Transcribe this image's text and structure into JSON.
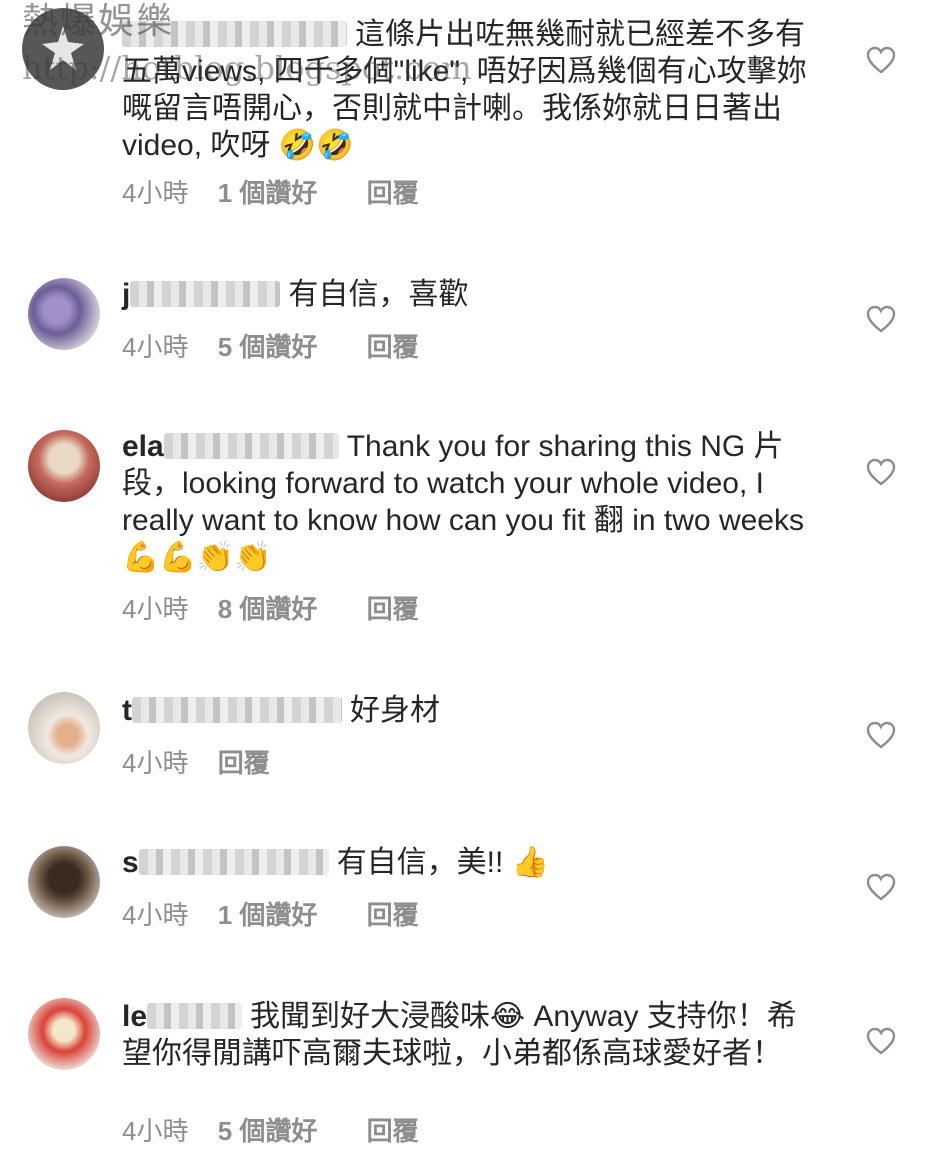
{
  "watermark": {
    "title": "熱爆娛樂",
    "url": "http://hotblog.blogspot.com"
  },
  "comments": [
    {
      "username_prefix": "",
      "text": "這條片出咗無幾耐就已經差不多有五萬views, 四千多個\"like\", 唔好因爲幾個有心攻擊妳嘅留言唔開心，否則就中計喇。我係妳就日日著出video, 吹呀 🤣🤣",
      "time": "4小時",
      "likes": "1 個讚好",
      "reply": "回覆",
      "avatar_color": "#ffffff"
    },
    {
      "username_prefix": "j",
      "text": "有自信，喜歡",
      "time": "4小時",
      "likes": "5 個讚好",
      "reply": "回覆",
      "avatar_color": "#7a6fa3"
    },
    {
      "username_prefix": "ela",
      "text": "Thank you for sharing this NG 片段，looking forward to watch your whole video, I really want to know how can you  fit 翻 in two weeks 💪💪👏👏",
      "time": "4小時",
      "likes": "8 個讚好",
      "reply": "回覆",
      "avatar_color": "#b85a4f"
    },
    {
      "username_prefix": "t",
      "text": "好身材",
      "time": "4小時",
      "likes": "",
      "reply": "回覆",
      "avatar_color": "#d9d2c8"
    },
    {
      "username_prefix": "s",
      "text": "有自信，美!! 👍",
      "time": "4小時",
      "likes": "1 個讚好",
      "reply": "回覆",
      "avatar_color": "#4a3a2e"
    },
    {
      "username_prefix": "le",
      "text": "我聞到好大浸酸味😂 Anyway 支持你！希望你得閒講吓高爾夫球啦，小弟都係高球愛好者！",
      "time": "4小時",
      "likes": "5 個讚好",
      "reply": "回覆",
      "avatar_color": "#c9342b"
    }
  ],
  "icons": {
    "like": "heart-outline-icon"
  }
}
